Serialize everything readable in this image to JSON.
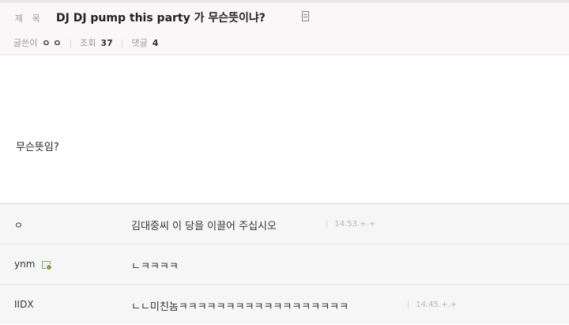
{
  "post": {
    "title_label": "제 목",
    "title": "DJ DJ pump this party 가 무슨뜻이냐?",
    "author_label": "글쓴이",
    "author": "ㅇ ㅇ",
    "views_label": "조회",
    "views": "37",
    "comments_label": "댓글",
    "comments_count": "4",
    "body": "무슨뜻임?"
  },
  "comments": [
    {
      "author": "ㅇ",
      "text": "김대중씨 이 당을 이끌어 주십시오",
      "time": "14.53.+.+"
    },
    {
      "author": "ynm",
      "text": "ㄴㅋㅋㅋㅋ",
      "time": ""
    },
    {
      "author": "IIDX",
      "text": "ㄴㄴ미친놈ㅋㅋㅋㅋㅋㅋㅋㅋㅋㅋㅋㅋㅋㅋㅋㅋㅋㅋ",
      "time": "14.45.+.+"
    }
  ],
  "icons": {
    "title_icon": "document-icon",
    "member_icon": "member-icon"
  }
}
